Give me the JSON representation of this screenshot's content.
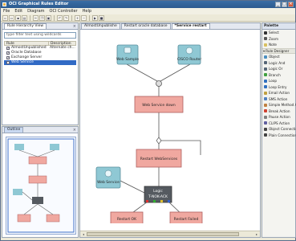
{
  "window": {
    "title": "OCI Graphical Rules Editor"
  },
  "menu": [
    "File",
    "Edit",
    "Diagram",
    "OCI Controller",
    "Help"
  ],
  "toolbar_icons": [
    "new-icon",
    "open-icon",
    "save-icon",
    "print-icon",
    "cut-icon",
    "copy-icon",
    "paste-icon",
    "undo-icon",
    "redo-icon",
    "zoom-in-icon",
    "zoom-out-icon",
    "run-icon",
    "stop-icon"
  ],
  "left_panel": {
    "tab": "Rule Hierarchy View",
    "filter_placeholder": "type filter text using wildcards",
    "columns": [
      "Rule",
      "Description"
    ],
    "rows": [
      {
        "name": "AlmostUnpublished",
        "desc": "Alternate ch...",
        "checked": true,
        "selected": false
      },
      {
        "name": "Oracle Database",
        "desc": "",
        "checked": true,
        "selected": false
      },
      {
        "name": "Exchange Server",
        "desc": "",
        "checked": true,
        "selected": false
      },
      {
        "name": "Web Service",
        "desc": "",
        "checked": true,
        "selected": true
      }
    ]
  },
  "outline_panel": {
    "tab": "Outline"
  },
  "editor": {
    "tabs": [
      {
        "label": "AlmostUnpublishe",
        "active": false
      },
      {
        "label": "Restart oracle database",
        "active": false
      },
      {
        "label": "*Service restart",
        "active": true
      }
    ],
    "nodes": {
      "websample": "Web Sample",
      "cisco": "CISCO Router",
      "service_down": "Web Service down",
      "restart": "Restart WebServices",
      "webservice": "Web Service",
      "logic": "Logic",
      "logic_sub": "T-NOK-ACK",
      "restart_ok": "Restart OK",
      "restart_failed": "Restart Failed"
    }
  },
  "palette": {
    "title": "Palette",
    "tools": [
      {
        "label": "Select",
        "icon": "select-arrow-icon",
        "color": "#333333"
      },
      {
        "label": "Zoom",
        "icon": "zoom-icon",
        "color": "#555555"
      },
      {
        "label": "Note",
        "icon": "note-icon",
        "color": "#d8c060"
      }
    ],
    "group": "Rule Designer",
    "items": [
      {
        "label": "Object",
        "icon": "object-icon",
        "color": "#4a8ec0"
      },
      {
        "label": "Logic And",
        "icon": "logic-and-icon",
        "color": "#556677"
      },
      {
        "label": "Logic Or",
        "icon": "logic-or-icon",
        "color": "#556677"
      },
      {
        "label": "Branch",
        "icon": "branch-icon",
        "color": "#40a040"
      },
      {
        "label": "Loop",
        "icon": "loop-icon",
        "color": "#3070c0"
      },
      {
        "label": "Loop Entry",
        "icon": "loop-entry-icon",
        "color": "#3070c0"
      },
      {
        "label": "Email Action",
        "icon": "email-icon",
        "color": "#c0a040"
      },
      {
        "label": "SMS Action",
        "icon": "sms-icon",
        "color": "#5080c0"
      },
      {
        "label": "Simple Method Action",
        "icon": "method-icon",
        "color": "#c08040"
      },
      {
        "label": "Break Action",
        "icon": "break-icon",
        "color": "#d04030"
      },
      {
        "label": "Pause Action",
        "icon": "pause-icon",
        "color": "#808080"
      },
      {
        "label": "CLIPS Action",
        "icon": "clips-icon",
        "color": "#6060a0"
      },
      {
        "label": "Object Connection",
        "icon": "connection-icon",
        "color": "#444444"
      },
      {
        "label": "Plain Connection",
        "icon": "plain-connection-icon",
        "color": "#444444"
      }
    ]
  },
  "colors": {
    "action_node": "#f0a8a0",
    "object_node": "#8fc8d4",
    "logic_node": "#555a60"
  }
}
